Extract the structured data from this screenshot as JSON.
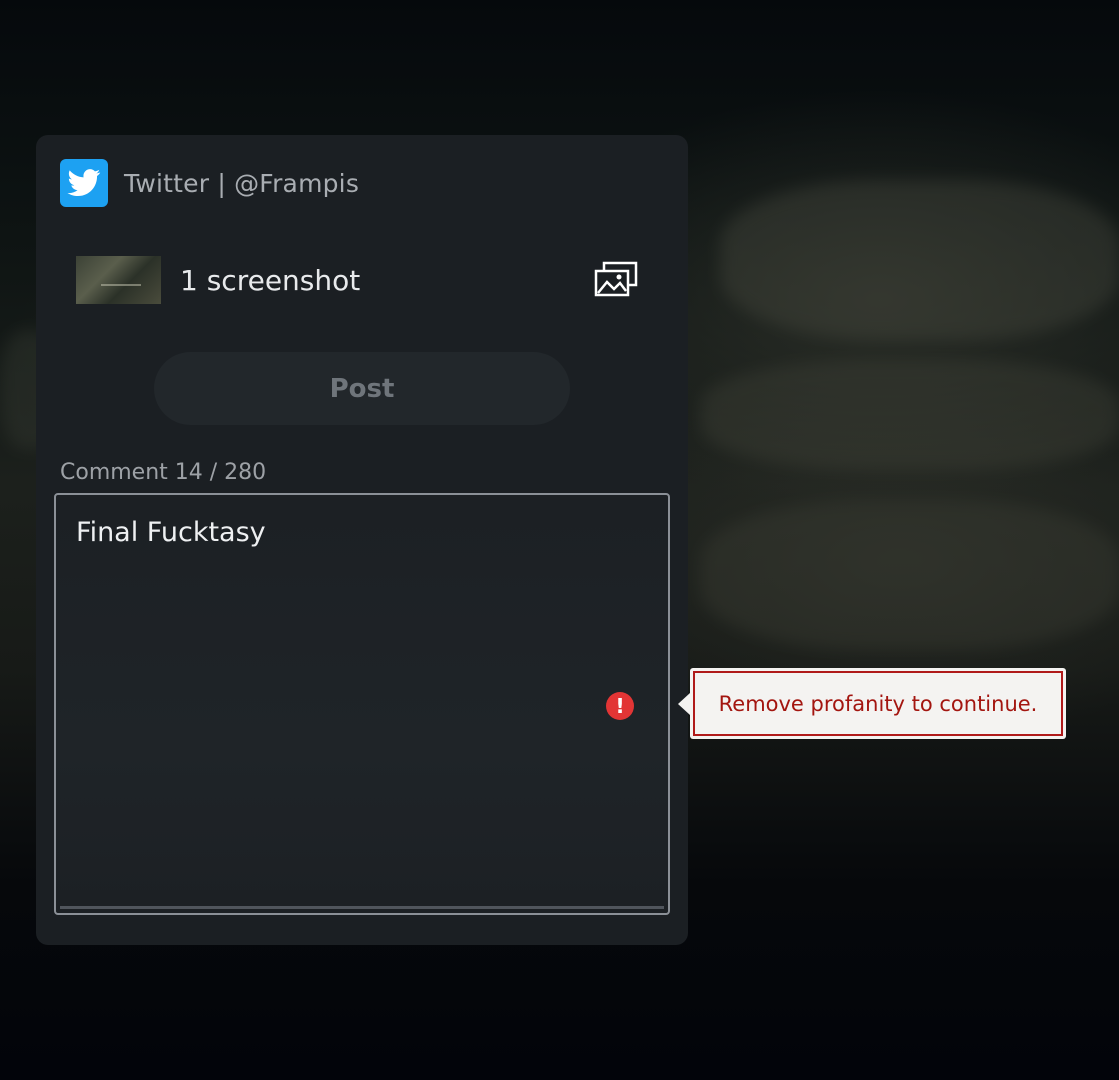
{
  "header": {
    "service": "Twitter",
    "separator": "|",
    "account": "@Frampis",
    "title": "Twitter | @Frampis"
  },
  "attachment": {
    "label": "1 screenshot",
    "count": 1
  },
  "post_button": {
    "label": "Post",
    "state": "disabled"
  },
  "comment": {
    "label": "Comment 14 / 280",
    "char_count": 14,
    "char_limit": 280,
    "value": "Final Fucktasy"
  },
  "error": {
    "icon_text": "!",
    "message": "Remove profanity to continue."
  },
  "colors": {
    "twitter_blue": "#1da1f2",
    "error_red": "#e23535",
    "tooltip_text": "#a3150f"
  },
  "icons": {
    "service": "twitter-bird-icon",
    "attachment": "gallery-icon",
    "error": "exclamation-icon"
  }
}
